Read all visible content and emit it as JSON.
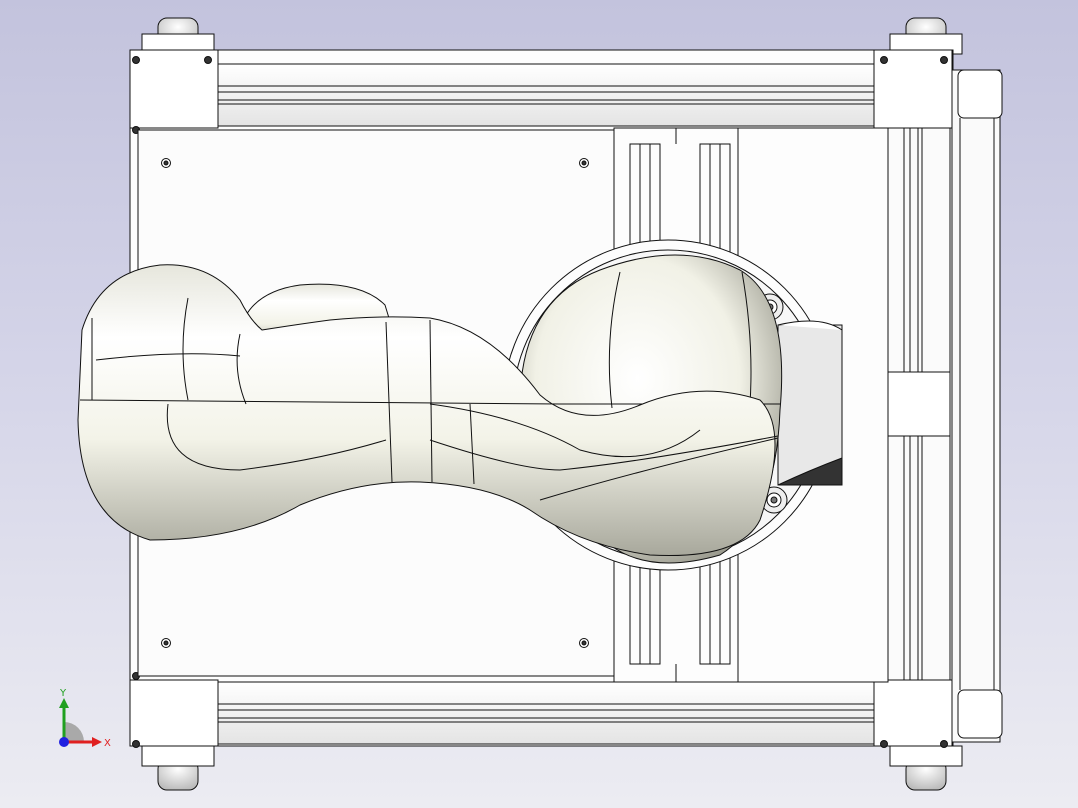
{
  "viewport": {
    "background_top": "#c3c3dd",
    "background_bottom": "#ececf2"
  },
  "model": {
    "parts": [
      "aluminum-frame",
      "caster-wheels",
      "base-plate",
      "linear-rail",
      "robot-arm",
      "shoulder-joint"
    ],
    "line_color": "#111111",
    "body_color": "#f6f6ef",
    "shadow_color": "#bdbdb2"
  },
  "triad": {
    "x_label": "X",
    "y_label": "Y",
    "x_color": "#e02020",
    "y_color": "#20a020",
    "z_color": "#2020e0"
  }
}
